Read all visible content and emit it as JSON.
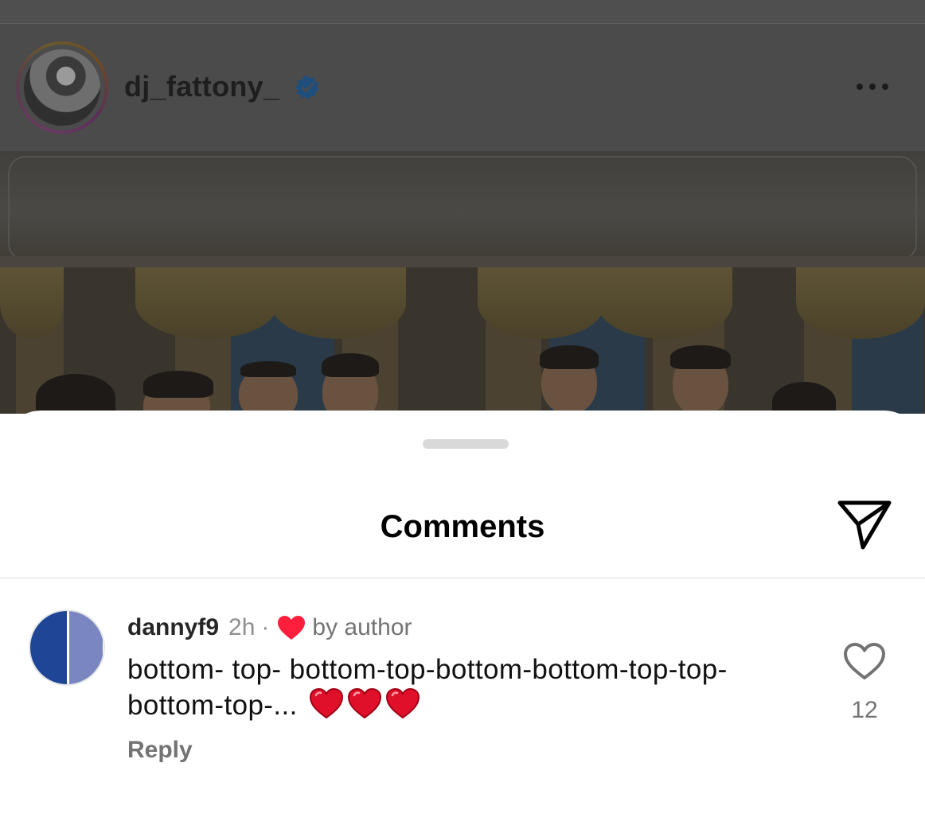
{
  "post": {
    "username": "dj_fattony_",
    "verified": true,
    "avatar_icon": "profile-avatar",
    "more_icon": "more-horizontal-icon"
  },
  "sheet": {
    "title": "Comments",
    "share_icon": "send-icon"
  },
  "comments": [
    {
      "username": "dannyf9",
      "time": "2h",
      "separator": "·",
      "liked_by_author_icon": "heart-filled-icon",
      "liked_by_author_label": "by author",
      "text": "bottom- top- bottom-top-bottom-bottom-top-top-bottom-top-...",
      "emojis": [
        "❤️",
        "❤️",
        "❤️"
      ],
      "reply_label": "Reply",
      "like_icon": "heart-outline-icon",
      "like_count": "12"
    }
  ],
  "colors": {
    "accent_red": "#ff3040",
    "verified_blue": "#0095f6",
    "secondary_text": "#737373"
  }
}
